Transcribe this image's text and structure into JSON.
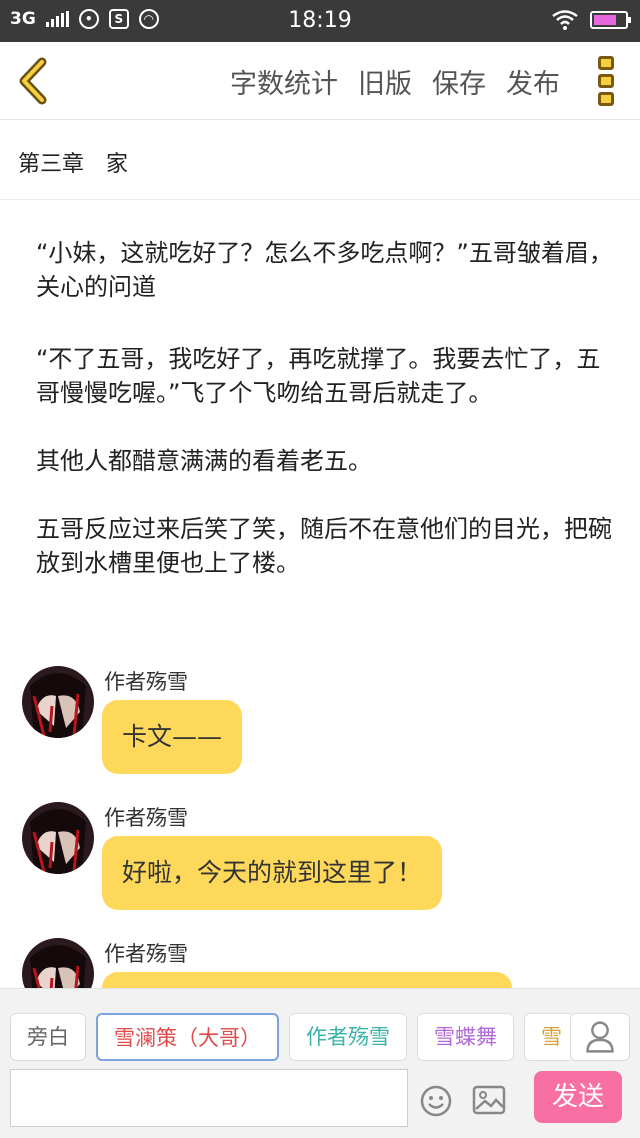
{
  "status_bar": {
    "network": "3G",
    "time": "18:19",
    "icons": [
      "signal-icon",
      "wechat-icon",
      "sim-icon",
      "qq-icon",
      "wifi-icon",
      "battery-icon"
    ]
  },
  "toolbar": {
    "back_icon": "chevron-left-icon",
    "actions": [
      "字数统计",
      "旧版",
      "保存",
      "发布"
    ],
    "menu_icon": "more-vertical-icon"
  },
  "chapter": {
    "number": "第三章",
    "title": "家"
  },
  "paragraphs": [
    "“小妹，这就吃好了？怎么不多吃点啊？”五哥皱着眉，关心的问道",
    "“不了五哥，我吃好了，再吃就撑了。我要去忙了，五哥慢慢吃喔。”飞了个飞吻给五哥后就走了。",
    "其他人都醋意满满的看着老五。",
    "五哥反应过来后笑了笑，随后不在意他们的目光，把碗放到水槽里便也上了楼。"
  ],
  "messages": [
    {
      "name": "作者殇雪",
      "text": "卡文——"
    },
    {
      "name": "作者殇雪",
      "text": "好啦，今天的就到这里了！"
    },
    {
      "name": "作者殇雪",
      "text": ""
    }
  ],
  "bottom_bar": {
    "roles": [
      {
        "label": "旁白",
        "color": "#666666"
      },
      {
        "label": "雪澜策（大哥）",
        "color": "#e04a4a"
      },
      {
        "label": "作者殇雪",
        "color": "#3bb3a8"
      },
      {
        "label": "雪蝶舞",
        "color": "#b36ad6"
      },
      {
        "label": "雪",
        "color": "#d8a43a"
      }
    ],
    "active_role_index": 1,
    "input_placeholder": "",
    "send_label": "发送",
    "accent_color": "#f76fa3",
    "bubble_color": "#fdd85a"
  }
}
